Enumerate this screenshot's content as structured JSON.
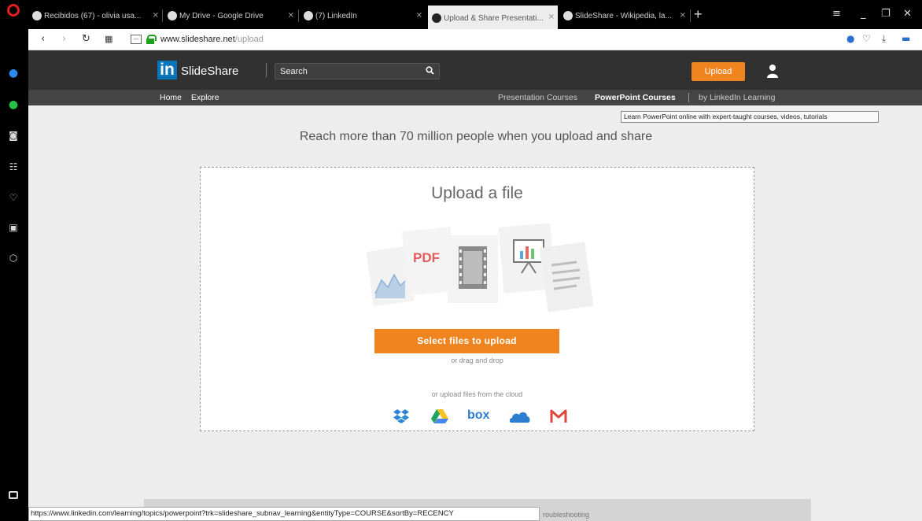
{
  "browser": {
    "tabs": [
      {
        "label": "Recibidos (67) - olivia usa..."
      },
      {
        "label": "My Drive - Google Drive"
      },
      {
        "label": "(7) LinkedIn"
      },
      {
        "label": "Upload & Share Presentati..."
      },
      {
        "label": "SlideShare - Wikipedia, la..."
      }
    ],
    "new_tab": "+",
    "url_host": "www.slideshare.net",
    "url_path": "/upload",
    "status_url": "https://www.linkedin.com/learning/topics/powerpoint?trk=slideshare_subnav_learning&entityType=COURSE&sortBy=RECENCY"
  },
  "header": {
    "logo": "in",
    "brand": "SlideShare",
    "search_placeholder": "Search",
    "upload_label": "Upload"
  },
  "subnav": {
    "home": "Home",
    "explore": "Explore",
    "presentation_courses": "Presentation Courses",
    "powerpoint_courses": "PowerPoint Courses",
    "linkedin_learning": "by LinkedIn Learning"
  },
  "tooltip": "Learn PowerPoint online with expert-taught courses, videos, tutorials",
  "main": {
    "headline": "Reach more than 70 million people when you upload and share",
    "upload_title": "Upload a file",
    "pdf_label": "PDF",
    "select_button": "Select files to upload",
    "drag_text": "or drag and drop",
    "cloud_text": "or upload files from the cloud",
    "box_label": "box"
  },
  "footer": {
    "troubleshooting": "roubleshooting"
  },
  "colors": {
    "accent": "#f0841f",
    "linkedin_blue": "#0a74b9",
    "header_bg": "#313131"
  }
}
